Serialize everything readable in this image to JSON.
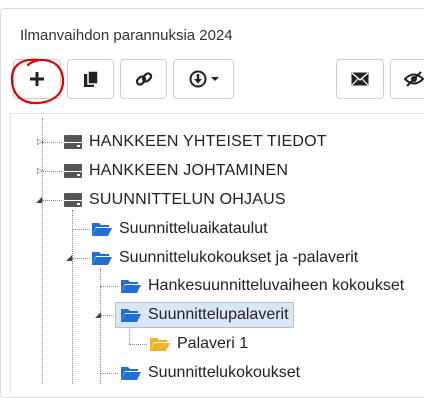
{
  "panel": {
    "title": "Ilmanvaihdon parannuksia 2024"
  },
  "toolbar": {
    "buttons": [
      {
        "name": "add-button",
        "icon": "plus-icon"
      },
      {
        "name": "copy-button",
        "icon": "copy-icon"
      },
      {
        "name": "link-button",
        "icon": "link-icon"
      },
      {
        "name": "download-dropdown-button",
        "icon": "download-icon"
      },
      {
        "name": "mail-button",
        "icon": "envelope-icon"
      },
      {
        "name": "visibility-button",
        "icon": "eye-slash-icon"
      }
    ]
  },
  "annotation": {
    "color": "#e00000",
    "shape": "hand-drawn-circle"
  },
  "tree": {
    "items": [
      {
        "label": "HANKKEEN YHTEISET TIEDOT",
        "icon": "drive-icon",
        "expander": "collapsed"
      },
      {
        "label": "HANKKEEN JOHTAMINEN",
        "icon": "drive-icon",
        "expander": "collapsed"
      },
      {
        "label": "SUUNNITTELUN OHJAUS",
        "icon": "drive-icon",
        "expander": "expanded"
      },
      {
        "label": "Suunnitteluaikataulut",
        "icon": "folder-open-icon"
      },
      {
        "label": "Suunnittelukokoukset ja -palaverit",
        "icon": "folder-open-icon",
        "expander": "expanded"
      },
      {
        "label": "Hankesuunnitteluvaiheen kokoukset",
        "icon": "folder-open-icon"
      },
      {
        "label": "Suunnittelupalaverit",
        "icon": "folder-open-icon",
        "expander": "expanded",
        "selected": true
      },
      {
        "label": "Palaveri 1",
        "icon": "folder-open-icon"
      },
      {
        "label": "Suunnittelukokoukset",
        "icon": "folder-open-icon"
      }
    ]
  },
  "colors": {
    "folder_blue": "#1e6fd9",
    "folder_yellow": "#f0b429",
    "selected_bg": "#dbe6f4",
    "drive_gray": "#555555"
  }
}
